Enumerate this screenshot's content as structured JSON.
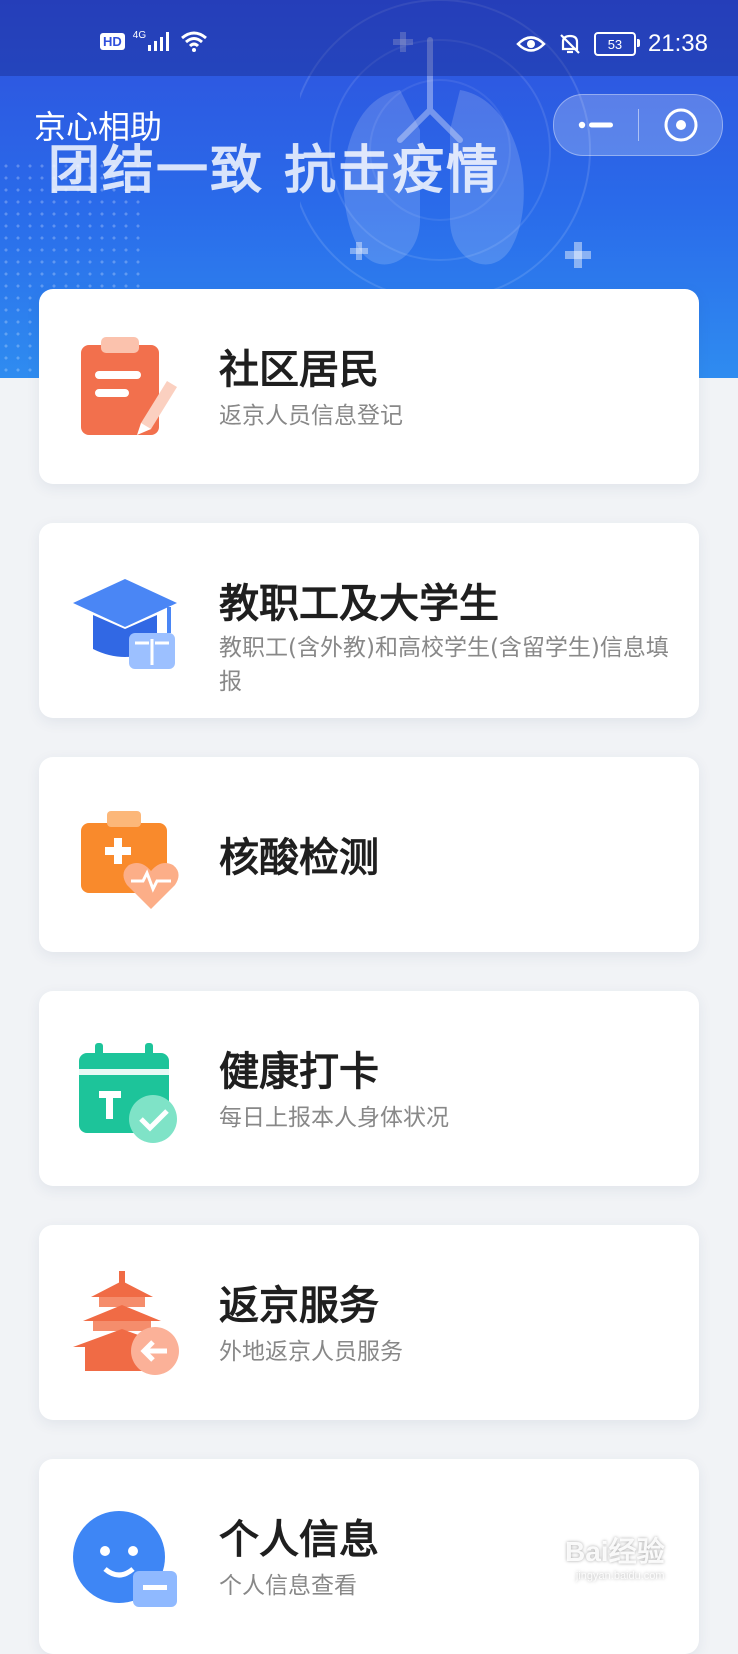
{
  "status_bar": {
    "hd": "HD",
    "network": "4G",
    "battery": "53",
    "time": "21:38",
    "icons": [
      "signal-icon",
      "wifi-icon",
      "eye-icon",
      "bell-off-icon",
      "battery-icon"
    ]
  },
  "header": {
    "app_title": "京心相助",
    "slogan": "团结一致 抗击疫情",
    "more_icon": "more-icon",
    "close_icon": "close-icon"
  },
  "menu": [
    {
      "title": "社区居民",
      "subtitle": "返京人员信息登记",
      "icon": "clipboard-icon",
      "color": "#f26b4b"
    },
    {
      "title": "教职工及大学生",
      "subtitle": "教职工(含外教)和高校学生(含留学生)信息填报",
      "icon": "graduation-cap-icon",
      "color": "#3d7bf3"
    },
    {
      "title": "核酸检测",
      "subtitle": "",
      "icon": "medical-kit-icon",
      "color": "#f98a2c"
    },
    {
      "title": "健康打卡",
      "subtitle": "每日上报本人身体状况",
      "icon": "calendar-check-icon",
      "color": "#1dc49a"
    },
    {
      "title": "返京服务",
      "subtitle": "外地返京人员服务",
      "icon": "temple-icon",
      "color": "#f06b45"
    },
    {
      "title": "个人信息",
      "subtitle": "个人信息查看",
      "icon": "profile-icon",
      "color": "#3e86f5"
    }
  ],
  "watermark": {
    "text": "Bai经验",
    "url_text": "jingyan.baidu.com"
  }
}
